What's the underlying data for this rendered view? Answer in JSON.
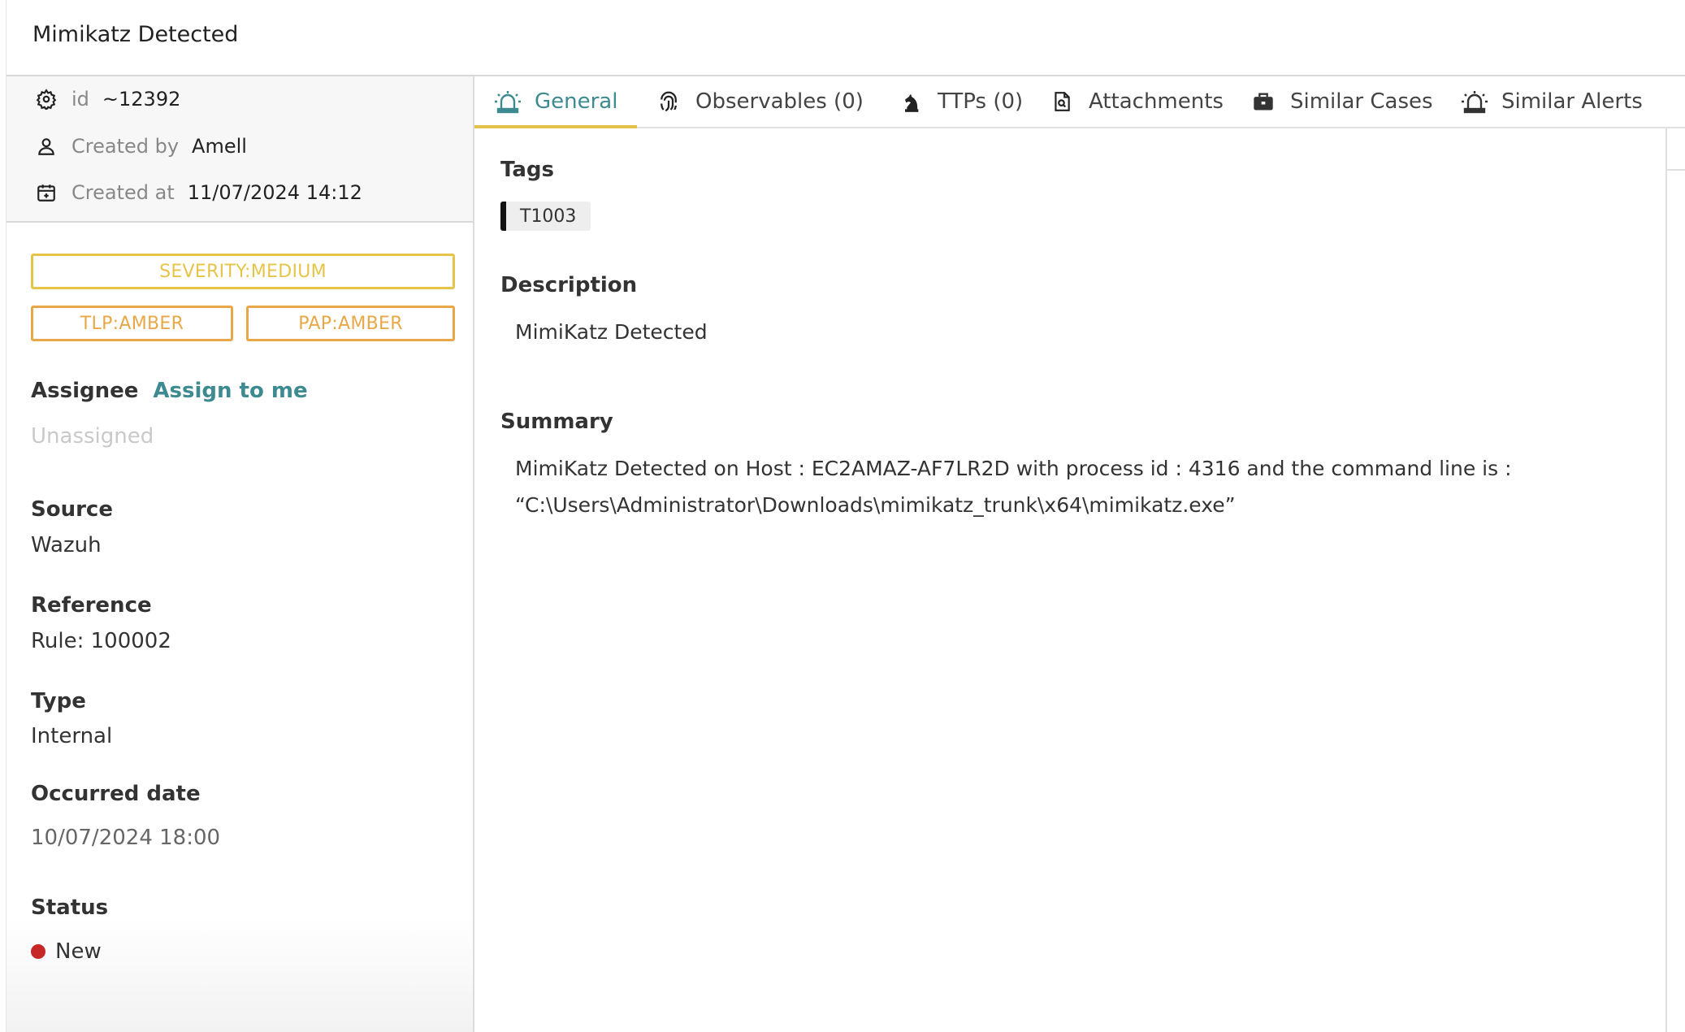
{
  "window": {
    "title": "Mimikatz Detected"
  },
  "meta": {
    "id_label": "id",
    "id_value": "~12392",
    "created_by_label": "Created by",
    "created_by_value": "Amell",
    "created_at_label": "Created at",
    "created_at_value": "11/07/2024 14:12"
  },
  "badges": {
    "severity": "SEVERITY:MEDIUM",
    "tlp": "TLP:AMBER",
    "pap": "PAP:AMBER"
  },
  "colors": {
    "severity": "#e6c44a",
    "amber": "#e9a847",
    "accent": "#3d8a91",
    "tab_underline": "#e3c24b",
    "status_new": "#c62828"
  },
  "fields": {
    "assignee_label": "Assignee",
    "assign_link": "Assign to me",
    "assignee_value": "Unassigned",
    "source_label": "Source",
    "source_value": "Wazuh",
    "reference_label": "Reference",
    "reference_value": "Rule: 100002",
    "type_label": "Type",
    "type_value": "Internal",
    "occurred_label": "Occurred date",
    "occurred_value": "10/07/2024 18:00",
    "status_label": "Status",
    "status_value": "New"
  },
  "tabs": [
    {
      "label": "General",
      "icon": "alert-siren-icon",
      "active": true
    },
    {
      "label": "Observables (0)",
      "icon": "fingerprint-icon"
    },
    {
      "label": "TTPs (0)",
      "icon": "chess-knight-icon"
    },
    {
      "label": "Attachments",
      "icon": "file-search-icon"
    },
    {
      "label": "Similar Cases",
      "icon": "briefcase-icon"
    },
    {
      "label": "Similar Alerts",
      "icon": "alert-siren-icon"
    }
  ],
  "general": {
    "tags_title": "Tags",
    "tags": [
      "T1003"
    ],
    "description_title": "Description",
    "description": "MimiKatz Detected",
    "summary_title": "Summary",
    "summary_line1": "MimiKatz Detected on Host : EC2AMAZ-AF7LR2D with process id : 4316 and the command line is :",
    "summary_line2": "“C:\\Users\\Administrator\\Downloads\\mimikatz_trunk\\x64\\mimikatz.exe”"
  }
}
